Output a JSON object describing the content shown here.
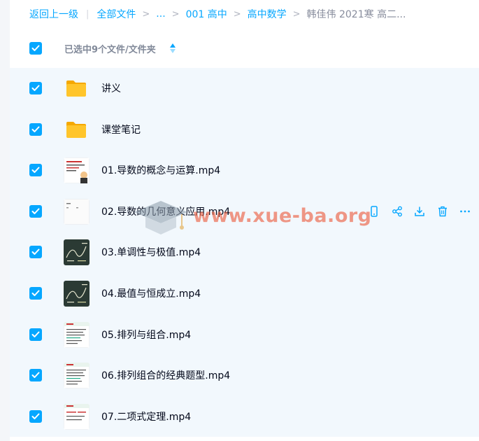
{
  "breadcrumb": {
    "back": "返回上一级",
    "items": [
      "全部文件",
      "...",
      "001 高中",
      "高中数学",
      "韩佳伟 2021寒 高二..."
    ]
  },
  "header": {
    "selection_text": "已选中9个文件/文件夹"
  },
  "colors": {
    "accent": "#06a7ff",
    "row_selected_bg": "#f2f8fd",
    "folder": "#ffc52b",
    "watermark": "#ec5a3c"
  },
  "files": [
    {
      "name": "讲义",
      "type": "folder"
    },
    {
      "name": "课堂笔记",
      "type": "folder"
    },
    {
      "name": "01.导数的概念与运算.mp4",
      "type": "video",
      "thumb": "slide-light"
    },
    {
      "name": "02.导数的几何意义应用.mp4",
      "type": "video",
      "thumb": "slide-white"
    },
    {
      "name": "03.单调性与极值.mp4",
      "type": "video",
      "thumb": "blackboard"
    },
    {
      "name": "04.最值与恒成立.mp4",
      "type": "video",
      "thumb": "blackboard"
    },
    {
      "name": "05.排列与组合.mp4",
      "type": "video",
      "thumb": "slide-green"
    },
    {
      "name": "06.排列组合的经典题型.mp4",
      "type": "video",
      "thumb": "slide-green"
    },
    {
      "name": "07.二项式定理.mp4",
      "type": "video",
      "thumb": "slide-red"
    }
  ],
  "row_actions": {
    "row_index": 3,
    "icons": [
      "phone-icon",
      "share-icon",
      "download-icon",
      "delete-icon",
      "more-icon"
    ]
  },
  "watermark": {
    "text": "www.xue-ba.org"
  }
}
